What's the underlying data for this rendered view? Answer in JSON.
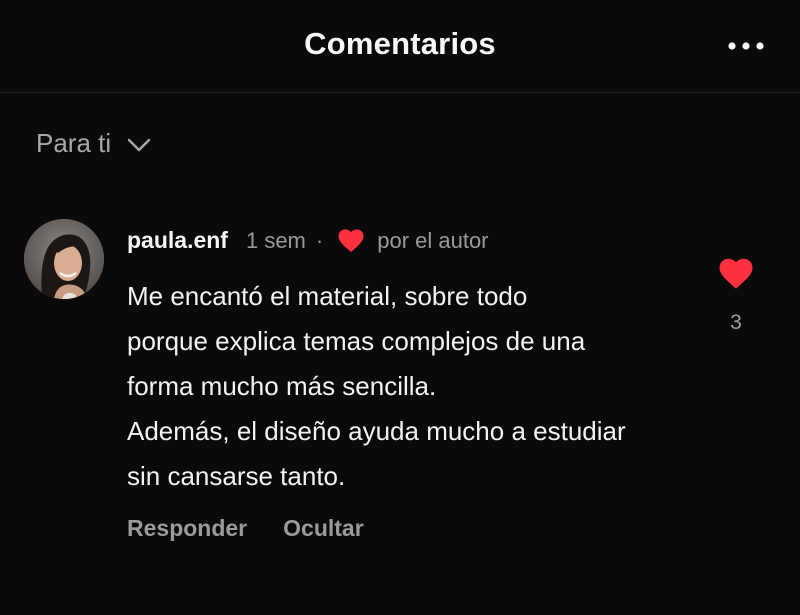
{
  "header": {
    "title": "Comentarios",
    "more_icon": "more-horizontal-icon"
  },
  "filter": {
    "label": "Para ti",
    "icon": "chevron-down-icon"
  },
  "comment": {
    "username": "paula.enf",
    "time": "1 sem",
    "separator": "·",
    "author_like_label": "por el autor",
    "lines": [
      "Me encantó el material, sobre todo",
      "porque explica temas complejos de una",
      "forma mucho más sencilla.",
      "Además, el diseño ayuda mucho a estudiar",
      "sin cansarse tanto."
    ],
    "actions": {
      "reply": "Responder",
      "hide": "Ocultar"
    },
    "like_count": "3",
    "like_icon": "heart-icon"
  },
  "colors": {
    "background": "#0a0a0a",
    "heart": "#ff3040",
    "muted_text": "#9a9a9a"
  }
}
